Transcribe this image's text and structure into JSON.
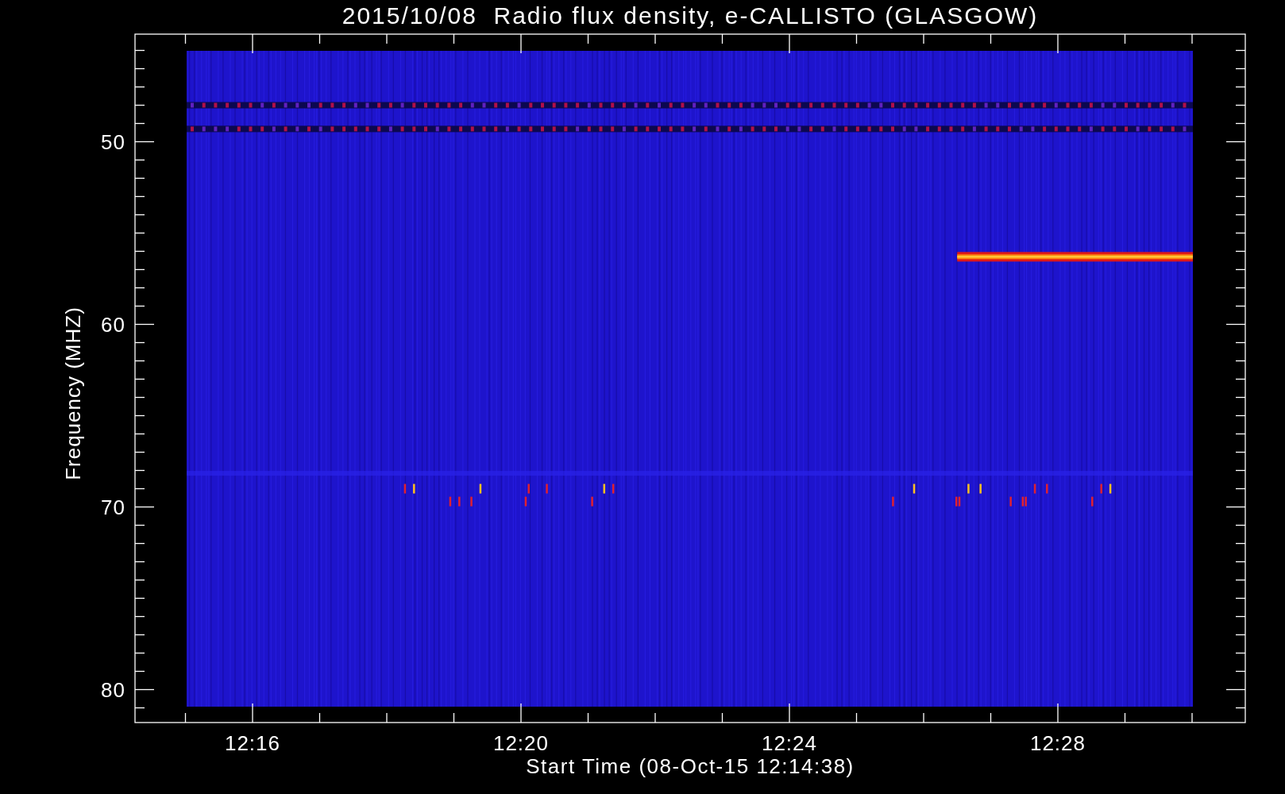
{
  "chart": {
    "title": "2015/10/08  Radio flux density, e-CALLISTO (GLASGOW)",
    "xlabel": "Start Time (08-Oct-15 12:14:38)",
    "ylabel": "Frequency (MHZ)",
    "xticks": [
      "12:16",
      "12:20",
      "12:24",
      "12:28"
    ],
    "yticks": [
      "50",
      "60",
      "70",
      "80"
    ]
  }
}
